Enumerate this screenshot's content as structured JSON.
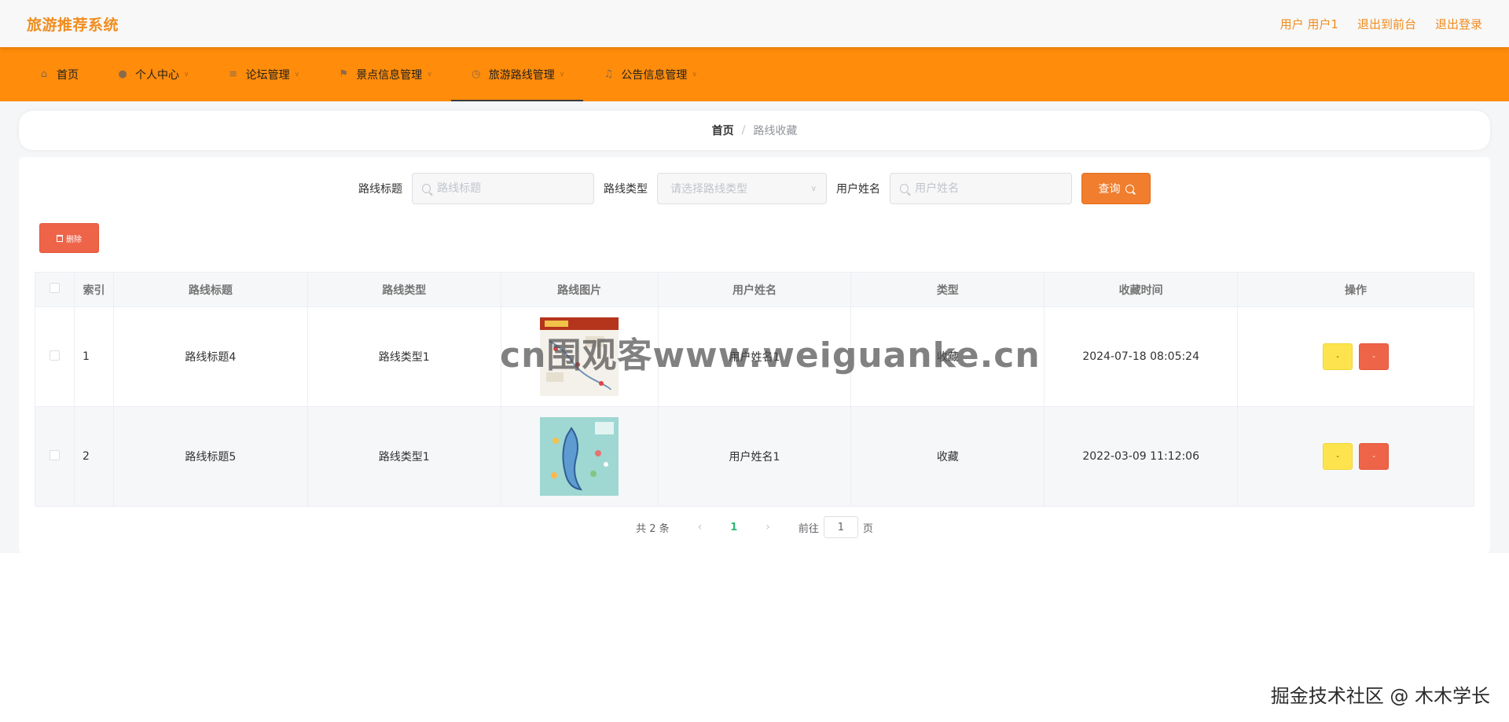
{
  "header": {
    "brand": "旅游推荐系统",
    "user_label": "用户 用户1",
    "back_to_front": "退出到前台",
    "logout": "退出登录"
  },
  "nav": {
    "items": [
      {
        "label": "首页",
        "icon": "home-icon",
        "has_caret": false
      },
      {
        "label": "个人中心",
        "icon": "user-icon",
        "has_caret": true
      },
      {
        "label": "论坛管理",
        "icon": "sliders-icon",
        "has_caret": true
      },
      {
        "label": "景点信息管理",
        "icon": "flag-icon",
        "has_caret": true
      },
      {
        "label": "旅游路线管理",
        "icon": "clock-icon",
        "has_caret": true,
        "active": true
      },
      {
        "label": "公告信息管理",
        "icon": "bell-icon",
        "has_caret": true
      }
    ]
  },
  "breadcrumb": {
    "home": "首页",
    "separator": "/",
    "current": "路线收藏"
  },
  "search": {
    "title_label": "路线标题",
    "title_placeholder": "路线标题",
    "type_label": "路线类型",
    "type_placeholder": "请选择路线类型",
    "username_label": "用户姓名",
    "username_placeholder": "用户姓名",
    "query_button": "查询"
  },
  "toolbar": {
    "delete_label": "删除"
  },
  "table": {
    "columns": [
      "索引",
      "路线标题",
      "路线类型",
      "路线图片",
      "用户姓名",
      "类型",
      "收藏时间",
      "操作"
    ],
    "rows": [
      {
        "index": "1",
        "title": "路线标题4",
        "type": "路线类型1",
        "image": "route-map-thumbnail",
        "username": "用户姓名1",
        "kind": "收藏",
        "time": "2024-07-18 08:05:24",
        "edit": "-",
        "del": "-"
      },
      {
        "index": "2",
        "title": "路线标题5",
        "type": "路线类型1",
        "image": "route-map-thumbnail",
        "username": "用户姓名1",
        "kind": "收藏",
        "time": "2022-03-09 11:12:06",
        "edit": "-",
        "del": "-"
      }
    ]
  },
  "pager": {
    "total": "共 2 条",
    "current_page": "1",
    "goto_prefix": "前往",
    "goto_value": "1",
    "goto_suffix": "页"
  },
  "watermarks": {
    "site": "cn围观客www.weiguanke.cn",
    "footer": "掘金技术社区 @ 木木学长"
  },
  "colors": {
    "brand": "#f08c1e",
    "nav_bg": "#ff8c0a",
    "query_button": "#f07e2e",
    "delete_button": "#ee6448",
    "edit_button": "#fde44f",
    "page_active": "#2bb673"
  }
}
